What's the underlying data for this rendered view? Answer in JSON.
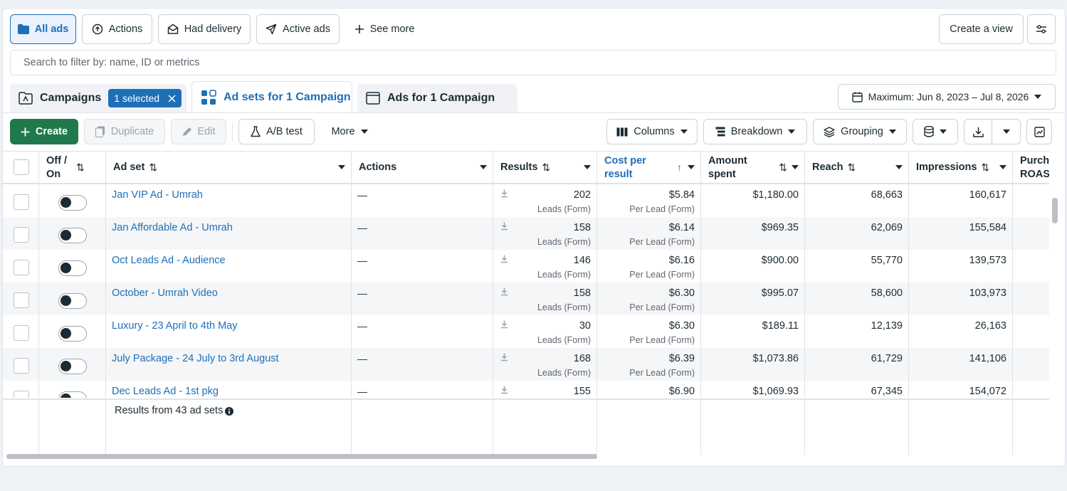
{
  "filters": {
    "all_ads": "All ads",
    "actions": "Actions",
    "had_delivery": "Had delivery",
    "active_ads": "Active ads",
    "see_more": "See more",
    "create_view": "Create a view"
  },
  "search": {
    "placeholder": "Search to filter by: name, ID or metrics"
  },
  "tabs": {
    "campaigns": "Campaigns",
    "selected": "1 selected",
    "adsets": "Ad sets for 1 Campaign",
    "ads": "Ads for 1 Campaign"
  },
  "date_range": "Maximum: Jun 8, 2023 – Jul 8, 2026",
  "toolbar": {
    "create": "Create",
    "duplicate": "Duplicate",
    "edit": "Edit",
    "ab_test": "A/B test",
    "more": "More",
    "columns": "Columns",
    "breakdown": "Breakdown",
    "grouping": "Grouping"
  },
  "columns": {
    "off_on": "Off / On",
    "ad_set": "Ad set",
    "actions": "Actions",
    "results": "Results",
    "cost_per_result": "Cost per result",
    "amount_spent": "Amount spent",
    "reach": "Reach",
    "impressions": "Impressions",
    "purchase_roas": "Purchase ROAS (re"
  },
  "rows": [
    {
      "name": "Jan VIP Ad - Umrah",
      "actions": "—",
      "results": "202",
      "results_sub": "Leads (Form)",
      "cost": "$5.84",
      "cost_sub": "Per Lead (Form)",
      "spent": "$1,180.00",
      "reach": "68,663",
      "impressions": "160,617"
    },
    {
      "name": "Jan Affordable Ad - Umrah",
      "actions": "—",
      "results": "158",
      "results_sub": "Leads (Form)",
      "cost": "$6.14",
      "cost_sub": "Per Lead (Form)",
      "spent": "$969.35",
      "reach": "62,069",
      "impressions": "155,584"
    },
    {
      "name": "Oct Leads Ad - Audience",
      "actions": "—",
      "results": "146",
      "results_sub": "Leads (Form)",
      "cost": "$6.16",
      "cost_sub": "Per Lead (Form)",
      "spent": "$900.00",
      "reach": "55,770",
      "impressions": "139,573"
    },
    {
      "name": "October - Umrah Video",
      "actions": "—",
      "results": "158",
      "results_sub": "Leads (Form)",
      "cost": "$6.30",
      "cost_sub": "Per Lead (Form)",
      "spent": "$995.07",
      "reach": "58,600",
      "impressions": "103,973"
    },
    {
      "name": "Luxury - 23 April to 4th May",
      "actions": "—",
      "results": "30",
      "results_sub": "Leads (Form)",
      "cost": "$6.30",
      "cost_sub": "Per Lead (Form)",
      "spent": "$189.11",
      "reach": "12,139",
      "impressions": "26,163"
    },
    {
      "name": "July Package - 24 July to 3rd August",
      "actions": "—",
      "results": "168",
      "results_sub": "Leads (Form)",
      "cost": "$6.39",
      "cost_sub": "Per Lead (Form)",
      "spent": "$1,073.86",
      "reach": "61,729",
      "impressions": "141,106"
    },
    {
      "name": "Dec Leads Ad - 1st pkg",
      "actions": "—",
      "results": "155",
      "results_sub": "",
      "cost": "$6.90",
      "cost_sub": "",
      "spent": "$1,069.93",
      "reach": "67,345",
      "impressions": "154,072"
    }
  ],
  "footer": {
    "summary": "Results from 43 ad sets"
  },
  "colors": {
    "accent": "#1d6fb8",
    "create_green": "#1e7a4c"
  }
}
